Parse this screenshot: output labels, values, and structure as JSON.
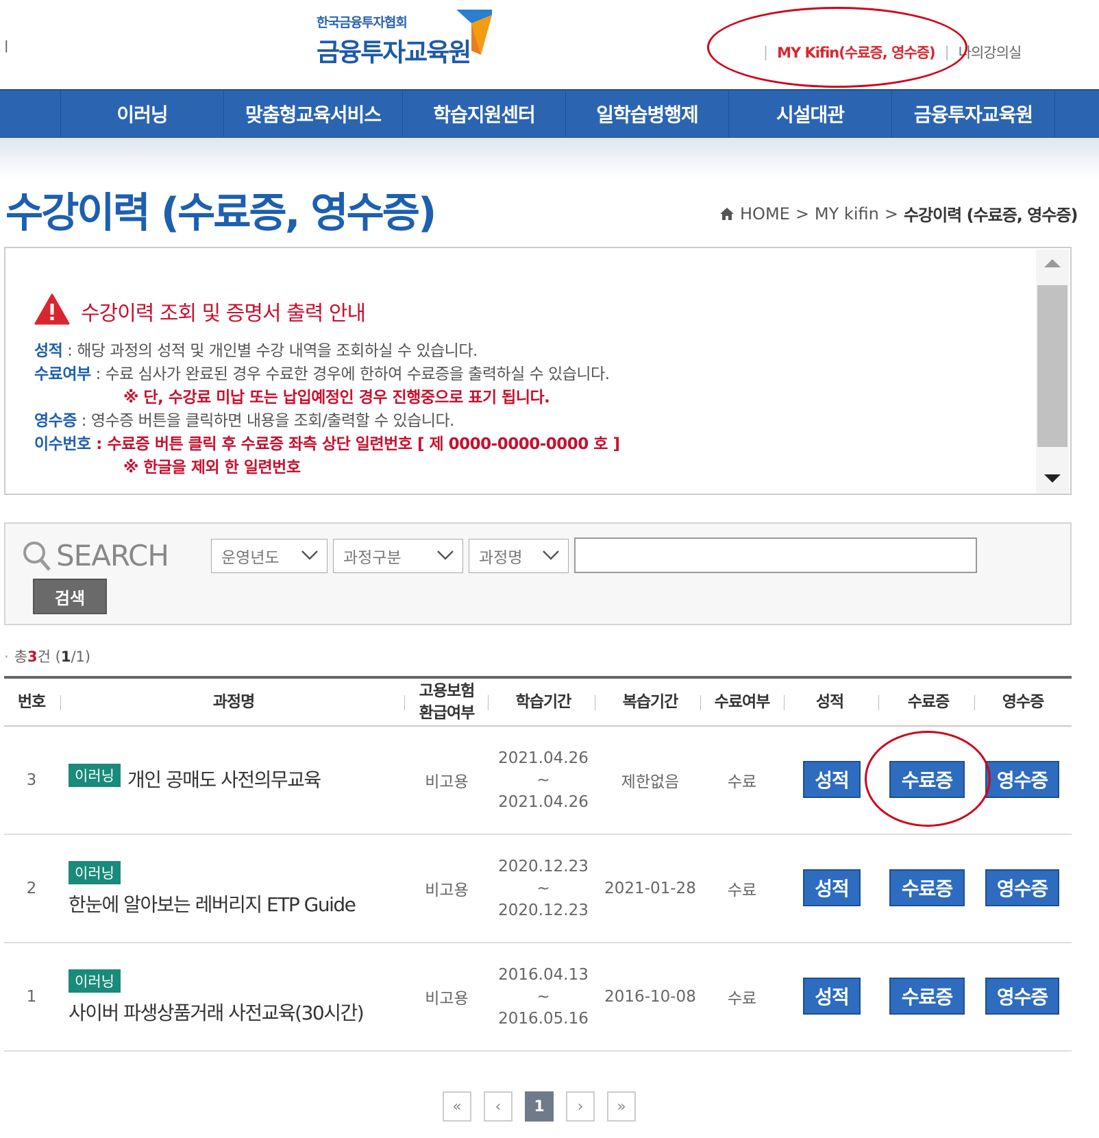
{
  "header": {
    "edge_char": "ㅣ",
    "logo_small": "한국금융투자협회",
    "logo_big": "금융투자교육원",
    "util_sep": "|",
    "my_kifin": "MY Kifin(수료증, 영수증)",
    "my_room": "나의강의실"
  },
  "nav": [
    "이러닝",
    "맞춤형교육서비스",
    "학습지원센터",
    "일학습병행제",
    "시설대관",
    "금융투자교육원"
  ],
  "page_title": "수강이력 (수료증, 영수증)",
  "breadcrumb": {
    "home": "HOME",
    "level1": "MY kifin",
    "current": "수강이력 (수료증, 영수증)",
    "separator": ">"
  },
  "notice": {
    "title": "수강이력 조회 및 증명서 출력 안내",
    "grade_key": "성적",
    "grade_text": " : 해당 과정의 성적 및 개인별 수강 내역을 조회하실 수 있습니다.",
    "complete_key": "수료여부",
    "complete_text": " : 수료 심사가 완료된 경우 수료한 경우에 한하여 수료증을 출력하실 수 있습니다.",
    "complete_note": "※ 단, 수강료 미납 또는 납입예정인 경우 진행중으로 표기 됩니다.",
    "receipt_key": "영수증",
    "receipt_text": " : 영수증 버튼을 클릭하면 내용을 조회/출력할 수 있습니다.",
    "serial_key": "이수번호",
    "serial_text": " : 수료증 버튼 클릭 후 수료증 좌측 상단 일련번호 [ 제 0000-0000-0000 호 ]",
    "serial_note": "※ 한글을 제외 한 일련번호"
  },
  "search": {
    "label": "SEARCH",
    "year_select": "운영년도",
    "type_select": "과정구분",
    "name_select": "과정명",
    "input_value": "",
    "button": "검색"
  },
  "count": {
    "prefix": "총",
    "total": "3",
    "unit": "건 (",
    "page": "1",
    "suffix": "/1)"
  },
  "table": {
    "headers": [
      "번호",
      "과정명",
      "고용보험",
      "환급여부",
      "학습기간",
      "복습기간",
      "수료여부",
      "성적",
      "수료증",
      "영수증"
    ],
    "rows": [
      {
        "no": "3",
        "badge": "이러닝",
        "course": "개인 공매도 사전의무교육",
        "insurance": "비고용",
        "start": "2021.04.26",
        "tilde": "~",
        "end": "2021.04.26",
        "review": "제한없음",
        "status": "수료",
        "grade_btn": "성적",
        "cert_btn": "수료증",
        "receipt_btn": "영수증"
      },
      {
        "no": "2",
        "badge": "이러닝",
        "course": "한눈에 알아보는 레버리지 ETP Guide",
        "insurance": "비고용",
        "start": "2020.12.23",
        "tilde": "~",
        "end": "2020.12.23",
        "review": "2021-01-28",
        "status": "수료",
        "grade_btn": "성적",
        "cert_btn": "수료증",
        "receipt_btn": "영수증"
      },
      {
        "no": "1",
        "badge": "이러닝",
        "course": "사이버 파생상품거래 사전교육(30시간)",
        "insurance": "비고용",
        "start": "2016.04.13",
        "tilde": "~",
        "end": "2016.05.16",
        "review": "2016-10-08",
        "status": "수료",
        "grade_btn": "성적",
        "cert_btn": "수료증",
        "receipt_btn": "영수증"
      }
    ]
  },
  "pagination": {
    "first": "«",
    "prev": "‹",
    "current": "1",
    "next": "›",
    "last": "»"
  },
  "colors": {
    "brand_blue": "#2b65b2",
    "title_blue": "#1d5fb0",
    "alert_red": "#c8102e",
    "badge_green": "#1a8a7a",
    "annotation_red": "#d0021b"
  }
}
